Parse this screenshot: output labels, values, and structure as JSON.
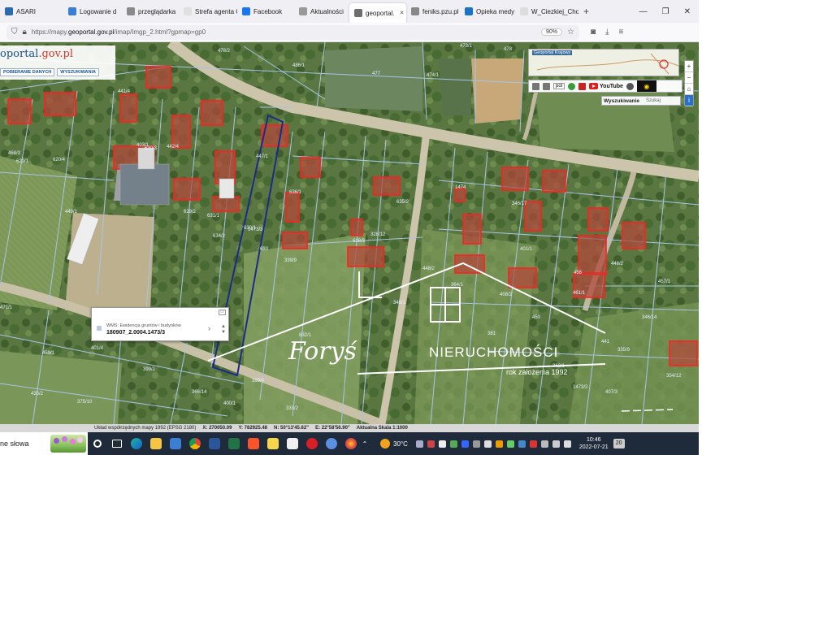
{
  "browser": {
    "tabs": [
      {
        "label": "ASARI",
        "favicon_color": "#2b6cb0"
      },
      {
        "label": "Logowanie d",
        "favicon_color": "#3a7ed6"
      },
      {
        "label": "przeglądarka",
        "favicon_color": "#8a8a8a"
      },
      {
        "label": "Strefa agenta Co",
        "favicon_color": "#e0e0e0"
      },
      {
        "label": "Facebook",
        "favicon_color": "#1877f2"
      },
      {
        "label": "Aktualności",
        "favicon_color": "#999999"
      },
      {
        "label": "geoportal.",
        "favicon_color": "#6d6d6d",
        "active": true
      },
      {
        "label": "feniks.pzu.pl",
        "favicon_color": "#888888"
      },
      {
        "label": "Opieka medy",
        "favicon_color": "#1a73c9"
      },
      {
        "label": "W_Ciezkiej_Chore",
        "favicon_color": "#dddddd"
      }
    ],
    "new_tab_symbol": "+",
    "window_buttons": {
      "minimize": "—",
      "restore": "❐",
      "close": "✕"
    },
    "url": {
      "prefix": "https://mapy.",
      "domain": "geoportal.gov.pl",
      "rest": "/imap/Imgp_2.html?gpmap=gp0"
    },
    "zoom": "90%"
  },
  "geoportal": {
    "logo_main": "oportal",
    "logo_gov": ".gov.pl",
    "menu_buttons": [
      "POBIERANIE DANYCH",
      "WYSZUKIWANIA"
    ],
    "minimap_title": "Geoportal Krajowy",
    "language_select": "pol",
    "youtube_label": "YouTube",
    "search_tab_label": "Wyszukiwanie",
    "search_tab_hint": "Szukaj",
    "zoom_in": "+",
    "zoom_out": "−",
    "popup": {
      "layer_name": "WMS: Ewidencja gruntów i budynków",
      "parcel_id": "180907_2.0004.1473/3"
    },
    "parcel_numbers": [
      "478/2",
      "486/1",
      "477",
      "474/1",
      "473/1",
      "478",
      "472/6",
      "469/2",
      "629/1",
      "620/4",
      "630/3",
      "629/2",
      "631/1",
      "630/1",
      "633",
      "634/2",
      "632/1",
      "636/1",
      "628/3",
      "635/2",
      "1473/3",
      "1474",
      "401/1",
      "461/1",
      "446/2",
      "457/1",
      "471/1",
      "459/1",
      "401/4",
      "399/2",
      "366/14",
      "400/1",
      "435/2",
      "375/10",
      "333/2",
      "399/4",
      "364/1",
      "408/2",
      "407/3",
      "354/12",
      "1473/2",
      "450",
      "456",
      "441",
      "346/17",
      "346/1",
      "328/12",
      "339/9",
      "441/4",
      "403/1",
      "468/3",
      "449/1",
      "442/4",
      "447/1",
      "448/2",
      "381",
      "362/1",
      "335/9",
      "346/14"
    ]
  },
  "watermark": {
    "signature": "Foryś",
    "title": "NIERUCHOMOŚCI",
    "subtitle": "rok założenia 1992"
  },
  "status": {
    "system": "Układ współrzędnych mapy 1992 (EPSG 2180)",
    "x": "X: 270050.09",
    "y": "Y: 782925.48",
    "n": "N: 50°13'45.62\"",
    "e": "E: 22°58'56.90\"",
    "scale": "Aktualna Skala 1:1000"
  },
  "taskbar": {
    "search_text": "ne słowa",
    "weather": "30°C",
    "time": "10:46",
    "date": "2022-07-21",
    "notifications": "20"
  },
  "colors": {
    "parcel_line": "#a8c4e4",
    "building_outline": "#ff2020",
    "selected_parcel": "#1c2a8a",
    "road": "#c9c1a7",
    "vegetation": "#5d7a44"
  }
}
